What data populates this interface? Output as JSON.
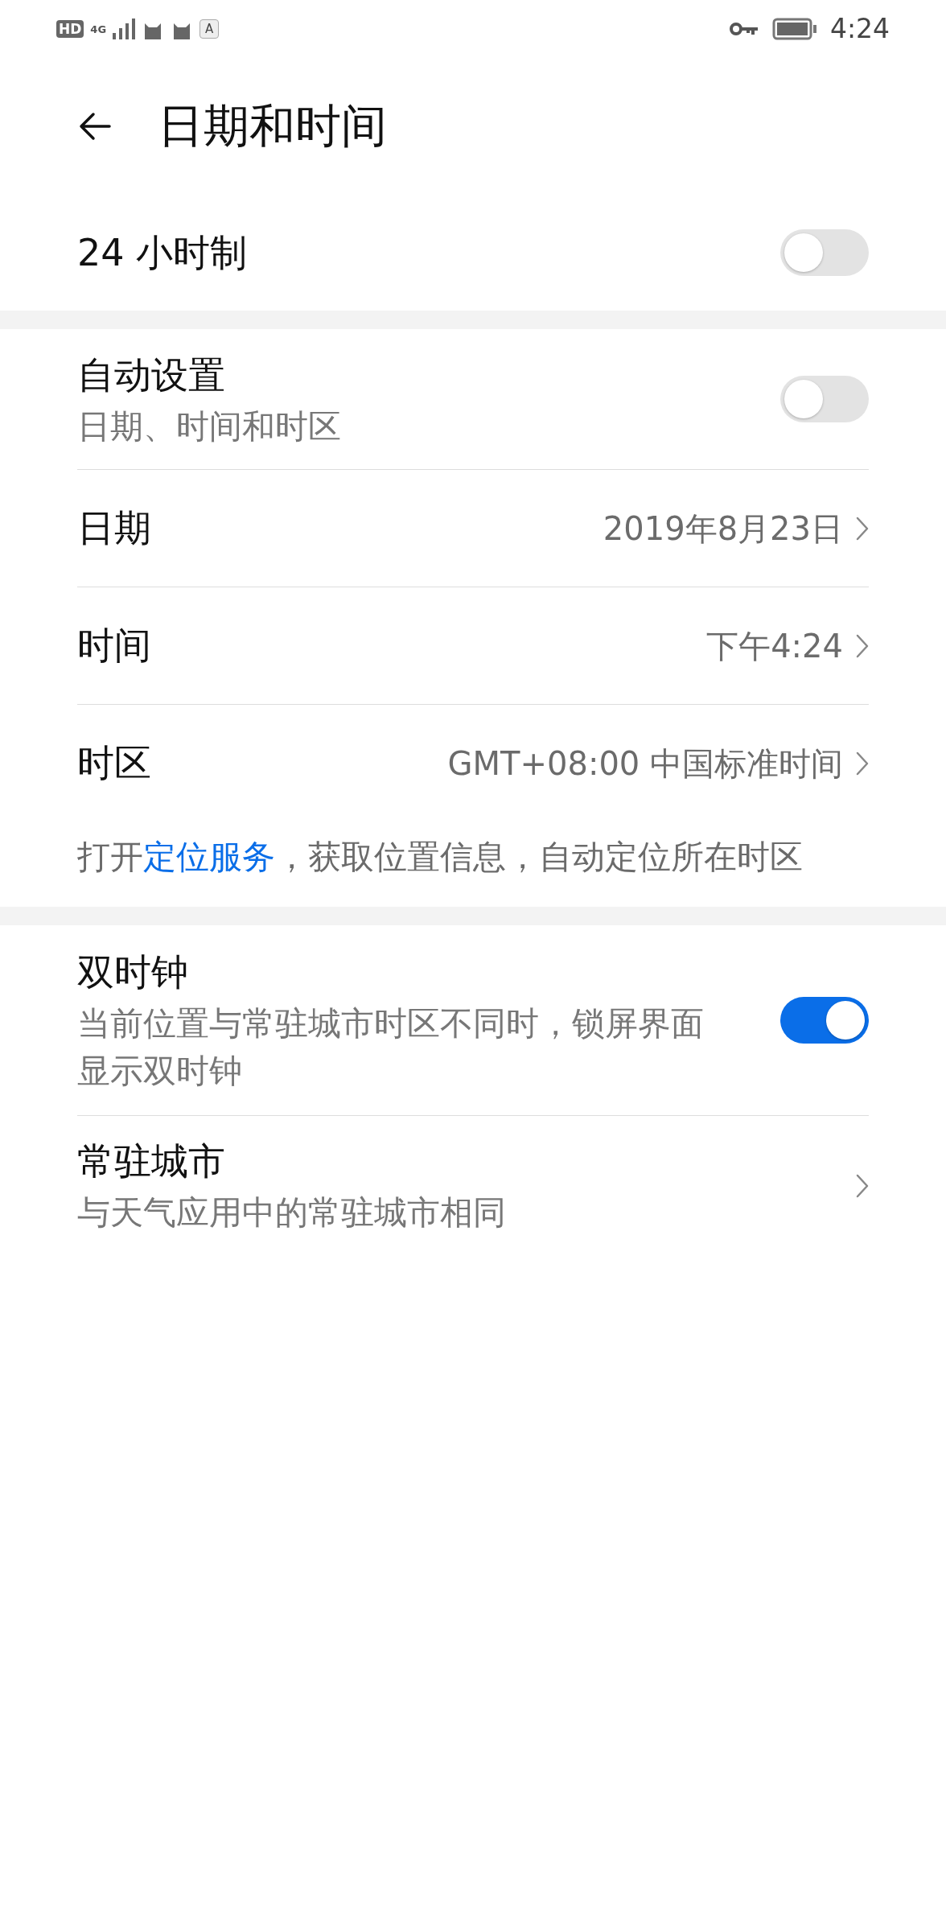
{
  "status_bar": {
    "hd_badge": "HD",
    "network": "4G",
    "keyboard_badge": "A",
    "time": "4:24"
  },
  "header": {
    "title": "日期和时间"
  },
  "sections": [
    {
      "items": [
        {
          "kind": "toggle",
          "label": "24 小时制",
          "on": false
        }
      ]
    },
    {
      "items": [
        {
          "kind": "toggle",
          "label": "自动设置",
          "subtitle": "日期、时间和时区",
          "on": false
        },
        {
          "kind": "nav",
          "label": "日期",
          "value": "2019年8月23日"
        },
        {
          "kind": "nav",
          "label": "时间",
          "value": "下午4:24"
        },
        {
          "kind": "nav",
          "label": "时区",
          "value": "GMT+08:00 中国标准时间"
        }
      ],
      "note": {
        "before": "打开",
        "link": "定位服务",
        "after": "，获取位置信息，自动定位所在时区"
      }
    },
    {
      "items": [
        {
          "kind": "toggle",
          "label": "双时钟",
          "subtitle": "当前位置与常驻城市时区不同时，锁屏界面显示双时钟",
          "on": true
        },
        {
          "kind": "nav",
          "label": "常驻城市",
          "subtitle": "与天气应用中的常驻城市相同"
        }
      ]
    }
  ]
}
